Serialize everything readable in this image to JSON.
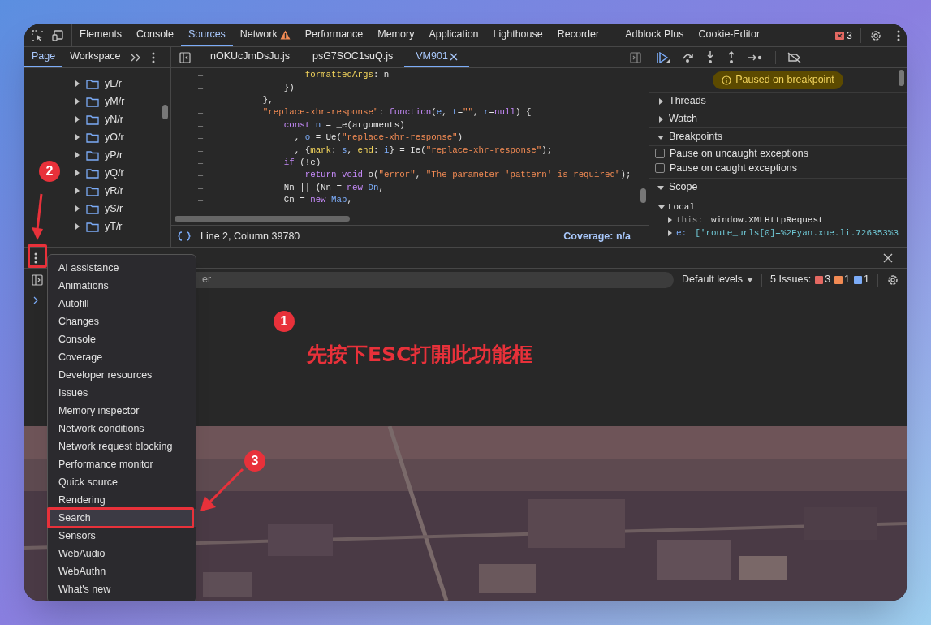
{
  "toolbar": {
    "tabs": [
      {
        "label": "Elements",
        "selected": false,
        "warning": false
      },
      {
        "label": "Console",
        "selected": false,
        "warning": false
      },
      {
        "label": "Sources",
        "selected": true,
        "warning": false
      },
      {
        "label": "Network",
        "selected": false,
        "warning": true
      },
      {
        "label": "Performance",
        "selected": false,
        "warning": false
      },
      {
        "label": "Memory",
        "selected": false,
        "warning": false
      },
      {
        "label": "Application",
        "selected": false,
        "warning": false
      },
      {
        "label": "Lighthouse",
        "selected": false,
        "warning": false
      },
      {
        "label": "Recorder",
        "selected": false,
        "warning": false
      },
      {
        "label": "Adblock Plus",
        "selected": false,
        "warning": false
      },
      {
        "label": "Cookie-Editor",
        "selected": false,
        "warning": false
      }
    ],
    "error_count": "3"
  },
  "navigator": {
    "tabs": [
      {
        "label": "Page",
        "selected": true
      },
      {
        "label": "Workspace",
        "selected": false
      }
    ],
    "folders": [
      "yL/r",
      "yM/r",
      "yN/r",
      "yO/r",
      "yP/r",
      "yQ/r",
      "yR/r",
      "yS/r",
      "yT/r"
    ]
  },
  "editor": {
    "tabs": [
      {
        "label": "nOKUcJmDsJu.js",
        "selected": false,
        "closable": false
      },
      {
        "label": "psG7SOC1suQ.js",
        "selected": false,
        "closable": false
      },
      {
        "label": "VM901",
        "selected": true,
        "closable": true
      }
    ],
    "lines": [
      {
        "gutter": "–",
        "tokens": [
          {
            "kind": "key",
            "text": "                formattedArgs"
          },
          {
            "kind": "plain",
            "text": ": n"
          }
        ]
      },
      {
        "gutter": "–",
        "tokens": [
          {
            "kind": "plain",
            "text": "            })"
          }
        ]
      },
      {
        "gutter": "–",
        "tokens": [
          {
            "kind": "plain",
            "text": "        },"
          }
        ]
      },
      {
        "gutter": "–",
        "tokens": [
          {
            "kind": "str",
            "text": "        \"replace-xhr-response\""
          },
          {
            "kind": "plain",
            "text": ": "
          },
          {
            "kind": "kw",
            "text": "function"
          },
          {
            "kind": "plain",
            "text": "("
          },
          {
            "kind": "var",
            "text": "e"
          },
          {
            "kind": "plain",
            "text": ", "
          },
          {
            "kind": "var",
            "text": "t"
          },
          {
            "kind": "plain",
            "text": "="
          },
          {
            "kind": "str",
            "text": "\"\""
          },
          {
            "kind": "plain",
            "text": ", "
          },
          {
            "kind": "var",
            "text": "r"
          },
          {
            "kind": "plain",
            "text": "="
          },
          {
            "kind": "kw",
            "text": "null"
          },
          {
            "kind": "plain",
            "text": ") {"
          }
        ]
      },
      {
        "gutter": "–",
        "tokens": [
          {
            "kind": "kw",
            "text": "            const"
          },
          {
            "kind": "var",
            "text": " n"
          },
          {
            "kind": "plain",
            "text": " = _e(arguments)"
          }
        ]
      },
      {
        "gutter": "–",
        "tokens": [
          {
            "kind": "plain",
            "text": "              , "
          },
          {
            "kind": "var",
            "text": "o"
          },
          {
            "kind": "plain",
            "text": " = Ue("
          },
          {
            "kind": "str",
            "text": "\"replace-xhr-response\""
          },
          {
            "kind": "plain",
            "text": ")"
          }
        ]
      },
      {
        "gutter": "–",
        "tokens": [
          {
            "kind": "plain",
            "text": "              , {"
          },
          {
            "kind": "key",
            "text": "mark"
          },
          {
            "kind": "plain",
            "text": ": "
          },
          {
            "kind": "var",
            "text": "s"
          },
          {
            "kind": "plain",
            "text": ", "
          },
          {
            "kind": "key",
            "text": "end"
          },
          {
            "kind": "plain",
            "text": ": "
          },
          {
            "kind": "var",
            "text": "i"
          },
          {
            "kind": "plain",
            "text": "} = Ie("
          },
          {
            "kind": "str",
            "text": "\"replace-xhr-response\""
          },
          {
            "kind": "plain",
            "text": ");"
          }
        ]
      },
      {
        "gutter": "–",
        "tokens": [
          {
            "kind": "kw",
            "text": "            if"
          },
          {
            "kind": "plain",
            "text": " (!e)"
          }
        ]
      },
      {
        "gutter": "–",
        "tokens": [
          {
            "kind": "kw",
            "text": "                return"
          },
          {
            "kind": "kw",
            "text": " void"
          },
          {
            "kind": "plain",
            "text": " o("
          },
          {
            "kind": "str",
            "text": "\"error\""
          },
          {
            "kind": "plain",
            "text": ", "
          },
          {
            "kind": "str",
            "text": "\"The parameter 'pattern' is required\""
          },
          {
            "kind": "plain",
            "text": ");"
          }
        ]
      },
      {
        "gutter": "–",
        "tokens": [
          {
            "kind": "plain",
            "text": "            Nn || (Nn = "
          },
          {
            "kind": "kw",
            "text": "new"
          },
          {
            "kind": "var",
            "text": " Dn"
          },
          {
            "kind": "plain",
            "text": ","
          }
        ]
      },
      {
        "gutter": "–",
        "tokens": [
          {
            "kind": "plain",
            "text": "            Cn = "
          },
          {
            "kind": "kw",
            "text": "new"
          },
          {
            "kind": "var",
            "text": " Map"
          },
          {
            "kind": "plain",
            "text": ","
          }
        ]
      }
    ],
    "position": "Line 2, Column 39780",
    "coverage": "Coverage: n/a"
  },
  "debugger": {
    "banner": "Paused on breakpoint",
    "sections": [
      {
        "title": "Threads",
        "expanded": false
      },
      {
        "title": "Watch",
        "expanded": false
      },
      {
        "title": "Breakpoints",
        "expanded": true,
        "options": [
          {
            "label": "Pause on uncaught exceptions",
            "checked": false
          },
          {
            "label": "Pause on caught exceptions",
            "checked": false
          }
        ]
      },
      {
        "title": "Scope",
        "expanded": true,
        "children": [
          {
            "label": "Local",
            "expanded": true,
            "children": [
              {
                "name": "this:",
                "value": "window.XMLHttpRequest",
                "expanded": false
              },
              {
                "name": "e:",
                "value": "['route_urls[0]=%2Fyan.xue.li.726353%3",
                "expanded": false
              }
            ]
          }
        ]
      }
    ]
  },
  "drawer": {
    "filter_placeholder": "er",
    "levels": "Default levels",
    "issues_label": "5 Issues:",
    "issues": [
      {
        "kind": "error",
        "count": "3"
      },
      {
        "kind": "warning",
        "count": "1"
      },
      {
        "kind": "info",
        "count": "1"
      }
    ]
  },
  "menu": {
    "items": [
      {
        "label": "AI assistance",
        "selected": false
      },
      {
        "label": "Animations",
        "selected": false
      },
      {
        "label": "Autofill",
        "selected": false
      },
      {
        "label": "Changes",
        "selected": false
      },
      {
        "label": "Console",
        "selected": false
      },
      {
        "label": "Coverage",
        "selected": false
      },
      {
        "label": "Developer resources",
        "selected": false
      },
      {
        "label": "Issues",
        "selected": false
      },
      {
        "label": "Memory inspector",
        "selected": false
      },
      {
        "label": "Network conditions",
        "selected": false
      },
      {
        "label": "Network request blocking",
        "selected": false
      },
      {
        "label": "Performance monitor",
        "selected": false
      },
      {
        "label": "Quick source",
        "selected": false
      },
      {
        "label": "Rendering",
        "selected": false
      },
      {
        "label": "Search",
        "selected": true
      },
      {
        "label": "Sensors",
        "selected": false
      },
      {
        "label": "WebAudio",
        "selected": false
      },
      {
        "label": "WebAuthn",
        "selected": false
      },
      {
        "label": "What's new",
        "selected": false
      }
    ]
  },
  "annotations": {
    "markers": [
      {
        "number": "1"
      },
      {
        "number": "2"
      },
      {
        "number": "3"
      }
    ],
    "caption": "先按下ESC打開此功能框"
  }
}
